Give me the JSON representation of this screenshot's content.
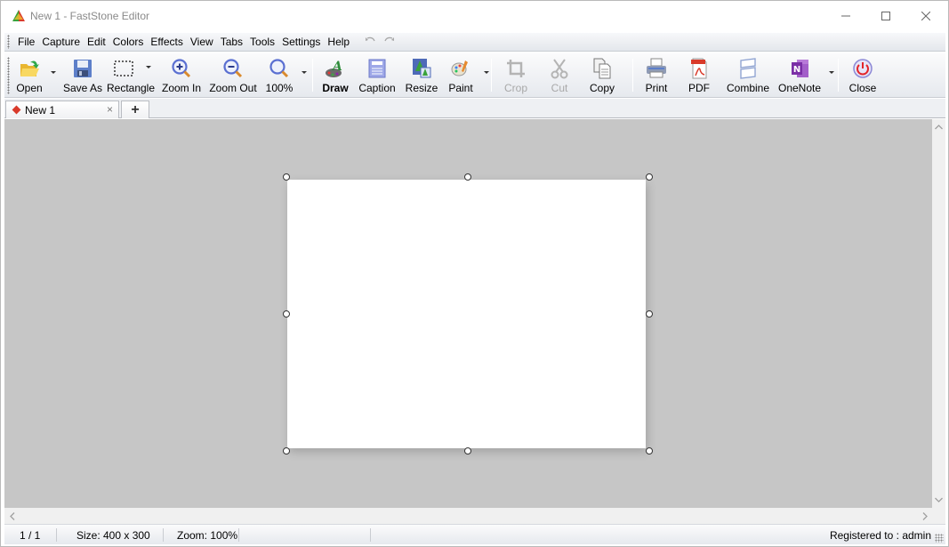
{
  "window": {
    "title": "New 1 - FastStone Editor",
    "controls": {
      "minimize": "minimize",
      "maximize": "maximize",
      "close": "close"
    }
  },
  "menu": {
    "items": [
      "File",
      "Capture",
      "Edit",
      "Colors",
      "Effects",
      "View",
      "Tabs",
      "Tools",
      "Settings",
      "Help"
    ],
    "undo_icon": "undo-icon",
    "redo_icon": "redo-icon"
  },
  "toolbar": {
    "buttons": [
      {
        "id": "open",
        "label": "Open",
        "icon": "open-folder-icon",
        "dropdown": true,
        "enabled": true
      },
      {
        "id": "save-as",
        "label": "Save As",
        "icon": "floppy-disk-icon",
        "dropdown": false,
        "enabled": true
      },
      {
        "id": "rectangle",
        "label": "Rectangle",
        "icon": "rectangle-select-icon",
        "dropdown": true,
        "enabled": true
      },
      {
        "id": "zoom-in",
        "label": "Zoom In",
        "icon": "zoom-in-icon",
        "dropdown": false,
        "enabled": true
      },
      {
        "id": "zoom-out",
        "label": "Zoom Out",
        "icon": "zoom-out-icon",
        "dropdown": false,
        "enabled": true
      },
      {
        "id": "zoom-100",
        "label": "100%",
        "icon": "magnifier-icon",
        "dropdown": true,
        "enabled": true
      },
      {
        "id": "draw",
        "label": "Draw",
        "icon": "draw-palette-icon",
        "dropdown": false,
        "enabled": true,
        "bold": true
      },
      {
        "id": "caption",
        "label": "Caption",
        "icon": "caption-icon",
        "dropdown": false,
        "enabled": true
      },
      {
        "id": "resize",
        "label": "Resize",
        "icon": "resize-icon",
        "dropdown": false,
        "enabled": true
      },
      {
        "id": "paint",
        "label": "Paint",
        "icon": "paint-palette-icon",
        "dropdown": true,
        "enabled": true
      },
      {
        "id": "crop",
        "label": "Crop",
        "icon": "crop-icon",
        "dropdown": false,
        "enabled": false
      },
      {
        "id": "cut",
        "label": "Cut",
        "icon": "scissors-icon",
        "dropdown": false,
        "enabled": false
      },
      {
        "id": "copy",
        "label": "Copy",
        "icon": "copy-icon",
        "dropdown": false,
        "enabled": true
      },
      {
        "id": "print",
        "label": "Print",
        "icon": "printer-icon",
        "dropdown": false,
        "enabled": true
      },
      {
        "id": "pdf",
        "label": "PDF",
        "icon": "pdf-icon",
        "dropdown": false,
        "enabled": true
      },
      {
        "id": "combine",
        "label": "Combine",
        "icon": "combine-icon",
        "dropdown": false,
        "enabled": true
      },
      {
        "id": "onenote",
        "label": "OneNote",
        "icon": "onenote-icon",
        "dropdown": true,
        "enabled": true
      },
      {
        "id": "close",
        "label": "Close",
        "icon": "power-icon",
        "dropdown": false,
        "enabled": true
      }
    ]
  },
  "tabs": {
    "items": [
      {
        "label": "New 1",
        "active": true
      }
    ],
    "close_glyph": "×",
    "new_tab_glyph": "+"
  },
  "canvas": {
    "background": "#c6c6c6",
    "image_background": "#ffffff"
  },
  "status": {
    "page": "1 / 1",
    "size": "Size: 400 x 300",
    "zoom": "Zoom: 100%",
    "registered": "Registered to : admin"
  },
  "colors": {
    "accent_red": "#d93a2a",
    "onenote_purple": "#7b2fa6",
    "zoom_blue": "#5a6fd1",
    "disabled_text": "#a8a8a8"
  }
}
